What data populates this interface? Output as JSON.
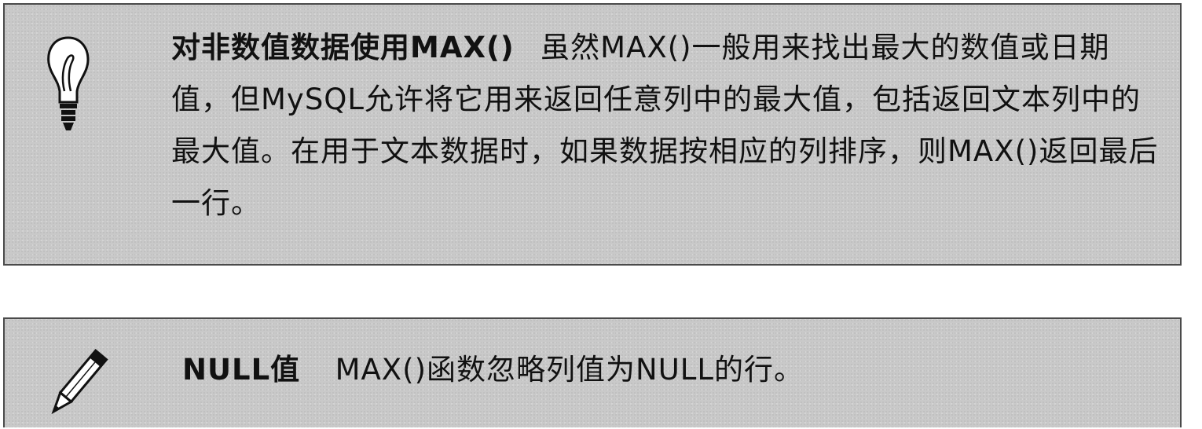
{
  "tip": {
    "icon": "lightbulb-icon",
    "title": "对非数值数据使用MAX()",
    "body": "虽然MAX()一般用来找出最大的数值或日期值，但MySQL允许将它用来返回任意列中的最大值，包括返回文本列中的最大值。在用于文本数据时，如果数据按相应的列排序，则MAX()返回最后一行。"
  },
  "note": {
    "icon": "pencil-icon",
    "title": "NULL值",
    "body": "MAX()函数忽略列值为NULL的行。"
  },
  "colors": {
    "box_background": "#c9c9c9",
    "box_border": "#4a4a4a",
    "text": "#111111"
  }
}
